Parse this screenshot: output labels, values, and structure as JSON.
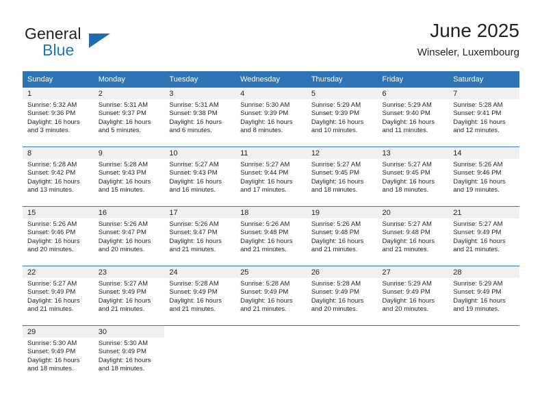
{
  "brand": {
    "word_one": "General",
    "word_two": "Blue",
    "triangle_icon": "brand-triangle-icon",
    "accent_color": "#1b75bb"
  },
  "header": {
    "title": "June 2025",
    "subtitle": "Winseler, Luxembourg"
  },
  "theme": {
    "header_blue": "#2e75b6",
    "daynum_strip": "#f0f0f0",
    "text": "#231f20"
  },
  "calendar": {
    "weekday_headers": [
      "Sunday",
      "Monday",
      "Tuesday",
      "Wednesday",
      "Thursday",
      "Friday",
      "Saturday"
    ],
    "weeks": [
      [
        {
          "day": "1",
          "sunrise": "Sunrise: 5:32 AM",
          "sunset": "Sunset: 9:36 PM",
          "daylight_1": "Daylight: 16 hours",
          "daylight_2": "and 3 minutes."
        },
        {
          "day": "2",
          "sunrise": "Sunrise: 5:31 AM",
          "sunset": "Sunset: 9:37 PM",
          "daylight_1": "Daylight: 16 hours",
          "daylight_2": "and 5 minutes."
        },
        {
          "day": "3",
          "sunrise": "Sunrise: 5:31 AM",
          "sunset": "Sunset: 9:38 PM",
          "daylight_1": "Daylight: 16 hours",
          "daylight_2": "and 6 minutes."
        },
        {
          "day": "4",
          "sunrise": "Sunrise: 5:30 AM",
          "sunset": "Sunset: 9:39 PM",
          "daylight_1": "Daylight: 16 hours",
          "daylight_2": "and 8 minutes."
        },
        {
          "day": "5",
          "sunrise": "Sunrise: 5:29 AM",
          "sunset": "Sunset: 9:39 PM",
          "daylight_1": "Daylight: 16 hours",
          "daylight_2": "and 10 minutes."
        },
        {
          "day": "6",
          "sunrise": "Sunrise: 5:29 AM",
          "sunset": "Sunset: 9:40 PM",
          "daylight_1": "Daylight: 16 hours",
          "daylight_2": "and 11 minutes."
        },
        {
          "day": "7",
          "sunrise": "Sunrise: 5:28 AM",
          "sunset": "Sunset: 9:41 PM",
          "daylight_1": "Daylight: 16 hours",
          "daylight_2": "and 12 minutes."
        }
      ],
      [
        {
          "day": "8",
          "sunrise": "Sunrise: 5:28 AM",
          "sunset": "Sunset: 9:42 PM",
          "daylight_1": "Daylight: 16 hours",
          "daylight_2": "and 13 minutes."
        },
        {
          "day": "9",
          "sunrise": "Sunrise: 5:28 AM",
          "sunset": "Sunset: 9:43 PM",
          "daylight_1": "Daylight: 16 hours",
          "daylight_2": "and 15 minutes."
        },
        {
          "day": "10",
          "sunrise": "Sunrise: 5:27 AM",
          "sunset": "Sunset: 9:43 PM",
          "daylight_1": "Daylight: 16 hours",
          "daylight_2": "and 16 minutes."
        },
        {
          "day": "11",
          "sunrise": "Sunrise: 5:27 AM",
          "sunset": "Sunset: 9:44 PM",
          "daylight_1": "Daylight: 16 hours",
          "daylight_2": "and 17 minutes."
        },
        {
          "day": "12",
          "sunrise": "Sunrise: 5:27 AM",
          "sunset": "Sunset: 9:45 PM",
          "daylight_1": "Daylight: 16 hours",
          "daylight_2": "and 18 minutes."
        },
        {
          "day": "13",
          "sunrise": "Sunrise: 5:27 AM",
          "sunset": "Sunset: 9:45 PM",
          "daylight_1": "Daylight: 16 hours",
          "daylight_2": "and 18 minutes."
        },
        {
          "day": "14",
          "sunrise": "Sunrise: 5:26 AM",
          "sunset": "Sunset: 9:46 PM",
          "daylight_1": "Daylight: 16 hours",
          "daylight_2": "and 19 minutes."
        }
      ],
      [
        {
          "day": "15",
          "sunrise": "Sunrise: 5:26 AM",
          "sunset": "Sunset: 9:46 PM",
          "daylight_1": "Daylight: 16 hours",
          "daylight_2": "and 20 minutes."
        },
        {
          "day": "16",
          "sunrise": "Sunrise: 5:26 AM",
          "sunset": "Sunset: 9:47 PM",
          "daylight_1": "Daylight: 16 hours",
          "daylight_2": "and 20 minutes."
        },
        {
          "day": "17",
          "sunrise": "Sunrise: 5:26 AM",
          "sunset": "Sunset: 9:47 PM",
          "daylight_1": "Daylight: 16 hours",
          "daylight_2": "and 21 minutes."
        },
        {
          "day": "18",
          "sunrise": "Sunrise: 5:26 AM",
          "sunset": "Sunset: 9:48 PM",
          "daylight_1": "Daylight: 16 hours",
          "daylight_2": "and 21 minutes."
        },
        {
          "day": "19",
          "sunrise": "Sunrise: 5:26 AM",
          "sunset": "Sunset: 9:48 PM",
          "daylight_1": "Daylight: 16 hours",
          "daylight_2": "and 21 minutes."
        },
        {
          "day": "20",
          "sunrise": "Sunrise: 5:27 AM",
          "sunset": "Sunset: 9:48 PM",
          "daylight_1": "Daylight: 16 hours",
          "daylight_2": "and 21 minutes."
        },
        {
          "day": "21",
          "sunrise": "Sunrise: 5:27 AM",
          "sunset": "Sunset: 9:49 PM",
          "daylight_1": "Daylight: 16 hours",
          "daylight_2": "and 21 minutes."
        }
      ],
      [
        {
          "day": "22",
          "sunrise": "Sunrise: 5:27 AM",
          "sunset": "Sunset: 9:49 PM",
          "daylight_1": "Daylight: 16 hours",
          "daylight_2": "and 21 minutes."
        },
        {
          "day": "23",
          "sunrise": "Sunrise: 5:27 AM",
          "sunset": "Sunset: 9:49 PM",
          "daylight_1": "Daylight: 16 hours",
          "daylight_2": "and 21 minutes."
        },
        {
          "day": "24",
          "sunrise": "Sunrise: 5:28 AM",
          "sunset": "Sunset: 9:49 PM",
          "daylight_1": "Daylight: 16 hours",
          "daylight_2": "and 21 minutes."
        },
        {
          "day": "25",
          "sunrise": "Sunrise: 5:28 AM",
          "sunset": "Sunset: 9:49 PM",
          "daylight_1": "Daylight: 16 hours",
          "daylight_2": "and 21 minutes."
        },
        {
          "day": "26",
          "sunrise": "Sunrise: 5:28 AM",
          "sunset": "Sunset: 9:49 PM",
          "daylight_1": "Daylight: 16 hours",
          "daylight_2": "and 20 minutes."
        },
        {
          "day": "27",
          "sunrise": "Sunrise: 5:29 AM",
          "sunset": "Sunset: 9:49 PM",
          "daylight_1": "Daylight: 16 hours",
          "daylight_2": "and 20 minutes."
        },
        {
          "day": "28",
          "sunrise": "Sunrise: 5:29 AM",
          "sunset": "Sunset: 9:49 PM",
          "daylight_1": "Daylight: 16 hours",
          "daylight_2": "and 19 minutes."
        }
      ],
      [
        {
          "day": "29",
          "sunrise": "Sunrise: 5:30 AM",
          "sunset": "Sunset: 9:49 PM",
          "daylight_1": "Daylight: 16 hours",
          "daylight_2": "and 18 minutes."
        },
        {
          "day": "30",
          "sunrise": "Sunrise: 5:30 AM",
          "sunset": "Sunset: 9:49 PM",
          "daylight_1": "Daylight: 16 hours",
          "daylight_2": "and 18 minutes."
        },
        {
          "day": "",
          "sunrise": "",
          "sunset": "",
          "daylight_1": "",
          "daylight_2": ""
        },
        {
          "day": "",
          "sunrise": "",
          "sunset": "",
          "daylight_1": "",
          "daylight_2": ""
        },
        {
          "day": "",
          "sunrise": "",
          "sunset": "",
          "daylight_1": "",
          "daylight_2": ""
        },
        {
          "day": "",
          "sunrise": "",
          "sunset": "",
          "daylight_1": "",
          "daylight_2": ""
        },
        {
          "day": "",
          "sunrise": "",
          "sunset": "",
          "daylight_1": "",
          "daylight_2": ""
        }
      ]
    ]
  }
}
